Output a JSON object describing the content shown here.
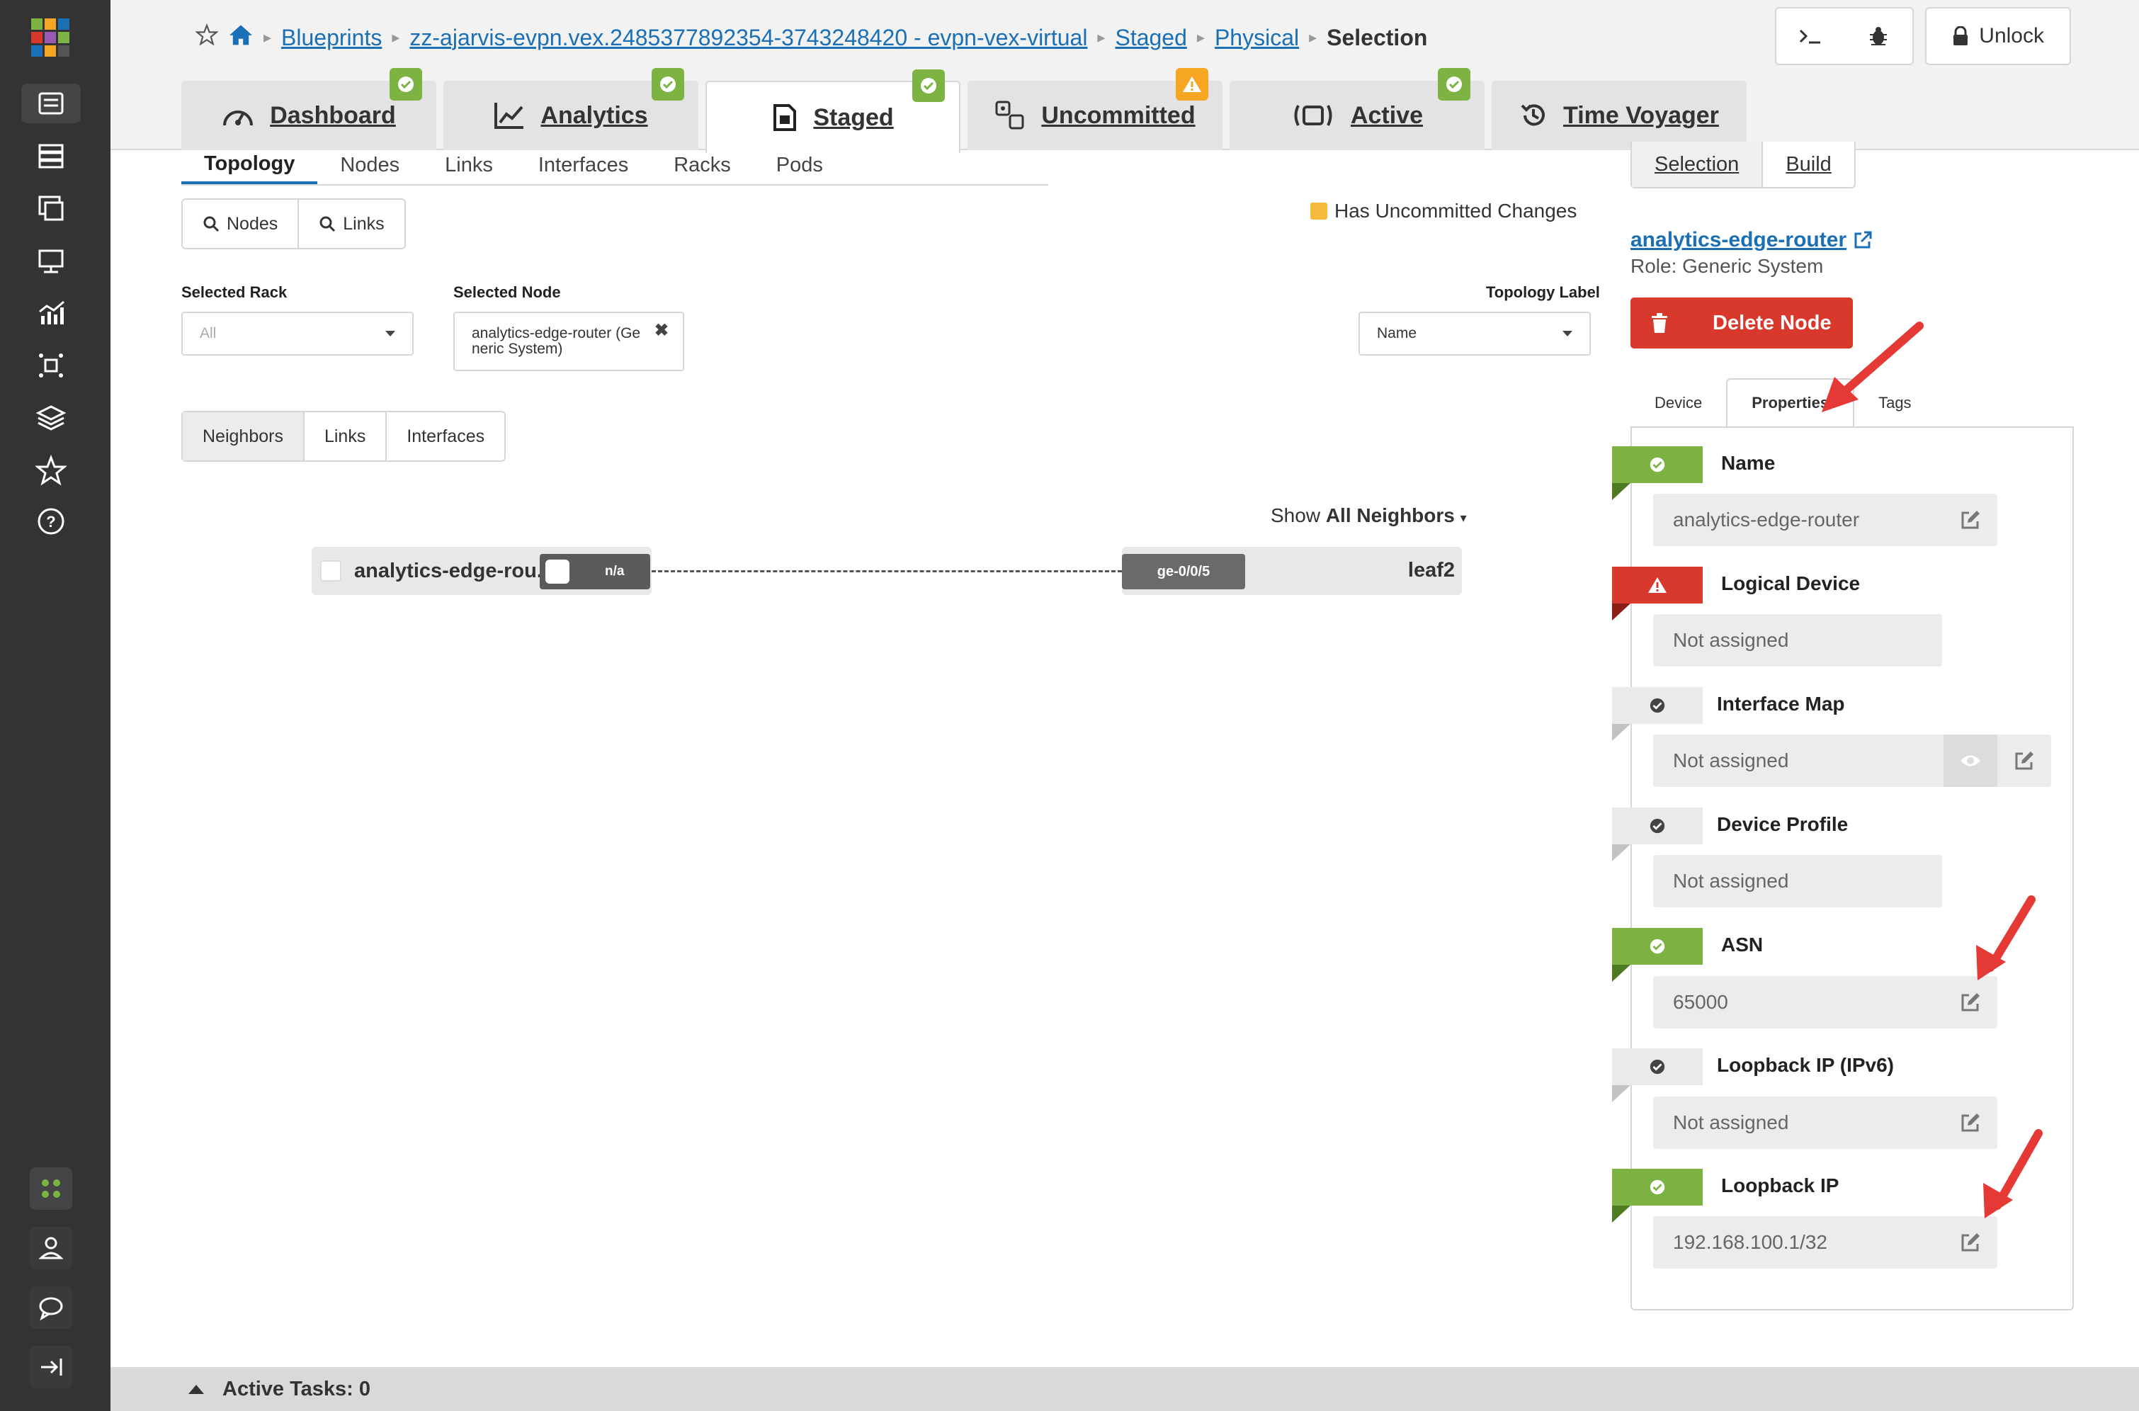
{
  "sidebar": {
    "items": [
      {
        "icon": "blueprints-icon",
        "active": true
      },
      {
        "icon": "devices-icon",
        "active": false
      },
      {
        "icon": "design-icon",
        "active": false
      },
      {
        "icon": "resources-icon",
        "active": false
      },
      {
        "icon": "analytics-icon",
        "active": false
      },
      {
        "icon": "network-icon",
        "active": false
      },
      {
        "icon": "layers-icon",
        "active": false
      },
      {
        "icon": "star-icon",
        "active": false
      },
      {
        "icon": "help-icon",
        "active": false
      }
    ],
    "bottom": [
      {
        "icon": "status-icon"
      },
      {
        "icon": "user-icon"
      },
      {
        "icon": "chat-icon"
      },
      {
        "icon": "collapse-icon"
      }
    ]
  },
  "breadcrumb": {
    "items": [
      "Blueprints",
      "zz-ajarvis-evpn.vex.2485377892354-3743248420 - evpn-vex-virtual",
      "Staged",
      "Physical"
    ],
    "current": "Selection"
  },
  "header": {
    "unlock_label": "Unlock"
  },
  "tabs": [
    {
      "label": "Dashboard",
      "icon": "dashboard-icon",
      "badge": "ok"
    },
    {
      "label": "Analytics",
      "icon": "analytics-chart-icon",
      "badge": "ok"
    },
    {
      "label": "Staged",
      "icon": "staged-icon",
      "badge": "ok",
      "active": true
    },
    {
      "label": "Uncommitted",
      "icon": "uncommitted-icon",
      "badge": "warn"
    },
    {
      "label": "Active",
      "icon": "active-icon",
      "badge": "ok"
    },
    {
      "label": "Time Voyager",
      "icon": "history-icon",
      "badge": null
    }
  ],
  "subtabs": [
    "Topology",
    "Nodes",
    "Links",
    "Interfaces",
    "Racks",
    "Pods"
  ],
  "search": {
    "nodes": "Nodes",
    "links": "Links"
  },
  "legend": {
    "label": "Has Uncommitted Changes",
    "color": "#f5b93b"
  },
  "filters": {
    "rack_label": "Selected Rack",
    "rack_value": "All",
    "node_label": "Selected Node",
    "node_value_line1": "analytics-edge-router (Ge",
    "node_value_line2": "neric System)",
    "topology_label": "Topology Label",
    "topology_value": "Name"
  },
  "view_toggle": [
    "Neighbors",
    "Links",
    "Interfaces"
  ],
  "neighbors": {
    "show_prefix": "Show",
    "show_value": "All Neighbors",
    "left_node": "analytics-edge-rou...",
    "left_port": "n/a",
    "right_port": "ge-0/0/5",
    "right_node": "leaf2"
  },
  "right_panel": {
    "toggle": [
      "Selection",
      "Build"
    ],
    "node_name": "analytics-edge-router",
    "role": "Role: Generic System",
    "delete_label": "Delete Node",
    "prop_tabs": [
      "Device",
      "Properties",
      "Tags"
    ],
    "properties": [
      {
        "name": "Name",
        "value": "analytics-edge-router",
        "status": "ok"
      },
      {
        "name": "Logical Device",
        "value": "Not assigned",
        "status": "err"
      },
      {
        "name": "Interface Map",
        "value": "Not assigned",
        "status": "neutral"
      },
      {
        "name": "Device Profile",
        "value": "Not assigned",
        "status": "neutral"
      },
      {
        "name": "ASN",
        "value": "65000",
        "status": "ok"
      },
      {
        "name": "Loopback IP (IPv6)",
        "value": "Not assigned",
        "status": "neutral"
      },
      {
        "name": "Loopback IP",
        "value": "192.168.100.1/32",
        "status": "ok"
      }
    ]
  },
  "bottom_bar": {
    "label": "Active Tasks: 0"
  },
  "colors": {
    "ok": "#7cb342",
    "warn": "#f5a623",
    "err": "#d9392d",
    "link": "#1a6fb5",
    "sidebar": "#333333"
  }
}
